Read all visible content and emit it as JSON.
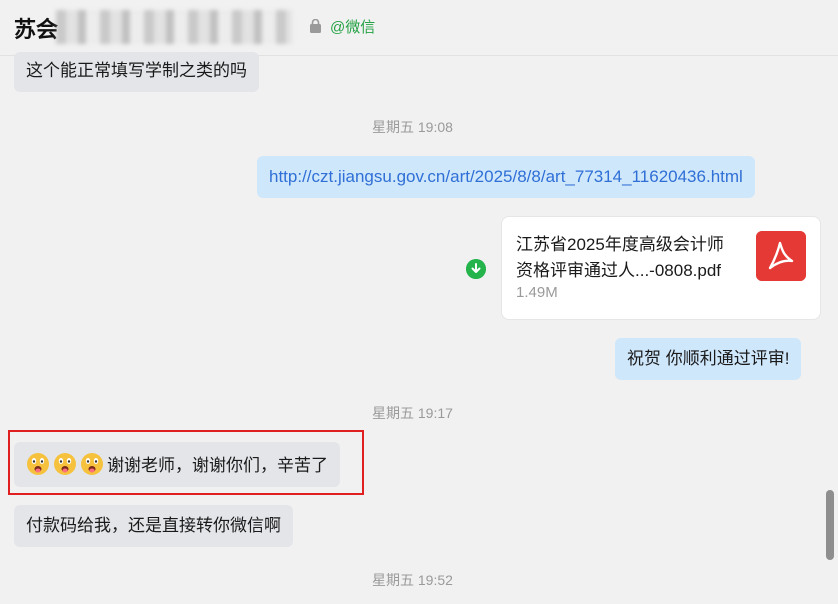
{
  "header": {
    "title": "苏会",
    "tag": "@微信"
  },
  "messages": {
    "m1": "这个能正常填写学制之类的吗",
    "t1": "星期五 19:08",
    "link": "http://czt.jiangsu.gov.cn/art/2025/8/8/art_77314_11620436.html",
    "file": {
      "name_line1": "江苏省2025年度高级会计师",
      "name_line2": "资格评审通过人...-0808.pdf",
      "size": "1.49M",
      "icon": "pdf-icon"
    },
    "m2": "祝贺 你顺利通过评审!",
    "t2": "星期五 19:17",
    "m3": "谢谢老师，谢谢你们，辛苦了",
    "m4": "付款码给我，还是直接转你微信啊",
    "t3": "星期五 19:52"
  },
  "colors": {
    "accent_green": "#25a244",
    "outgoing_bubble": "#cfe7fb",
    "incoming_bubble": "#e3e5e9",
    "highlight_border": "#e02020",
    "pdf_red": "#e53935"
  }
}
